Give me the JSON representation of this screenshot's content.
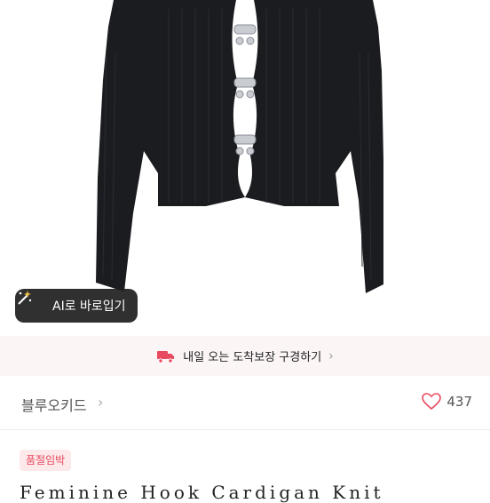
{
  "product": {
    "image_icon": "product-photo-cardigan",
    "ai_try_on_label": "AI로 바로입기",
    "ai_icon": "magic-wand-icon"
  },
  "delivery": {
    "text": "내일 오는 도착보장 구경하기",
    "icon": "truck-icon",
    "accent_color": "#e84a5f",
    "background": "#fbf5f6"
  },
  "shop": {
    "name": "블루오키드",
    "likes": "437"
  },
  "listing": {
    "badge": "품절임박",
    "title": "Feminine Hook Cardigan Knit"
  }
}
